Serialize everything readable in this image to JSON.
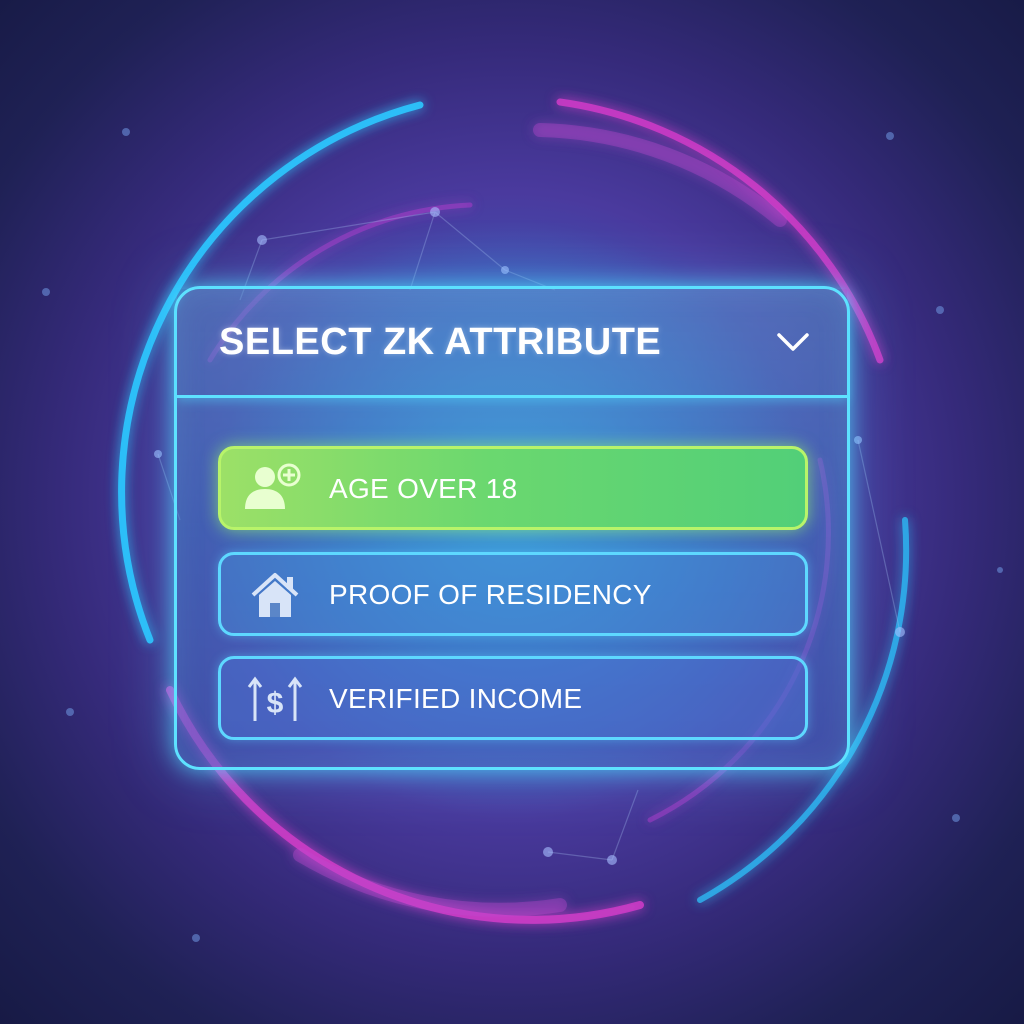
{
  "dropdown": {
    "title": "SELECT ZK ATTRIBUTE",
    "toggle_icon": "chevron-down-icon",
    "options": [
      {
        "label": "AGE OVER 18",
        "icon": "user-add-icon",
        "selected": true,
        "color": "#6bd86f"
      },
      {
        "label": "PROOF OF RESIDENCY",
        "icon": "home-icon",
        "selected": false
      },
      {
        "label": "VERIFIED INCOME",
        "icon": "income-icon",
        "selected": false
      }
    ]
  },
  "colors": {
    "accent_glow": "#5ee2ff",
    "selected_border": "#b8f46a",
    "ring_magenta": "#d03cc8",
    "ring_cyan": "#2ec8ff"
  }
}
